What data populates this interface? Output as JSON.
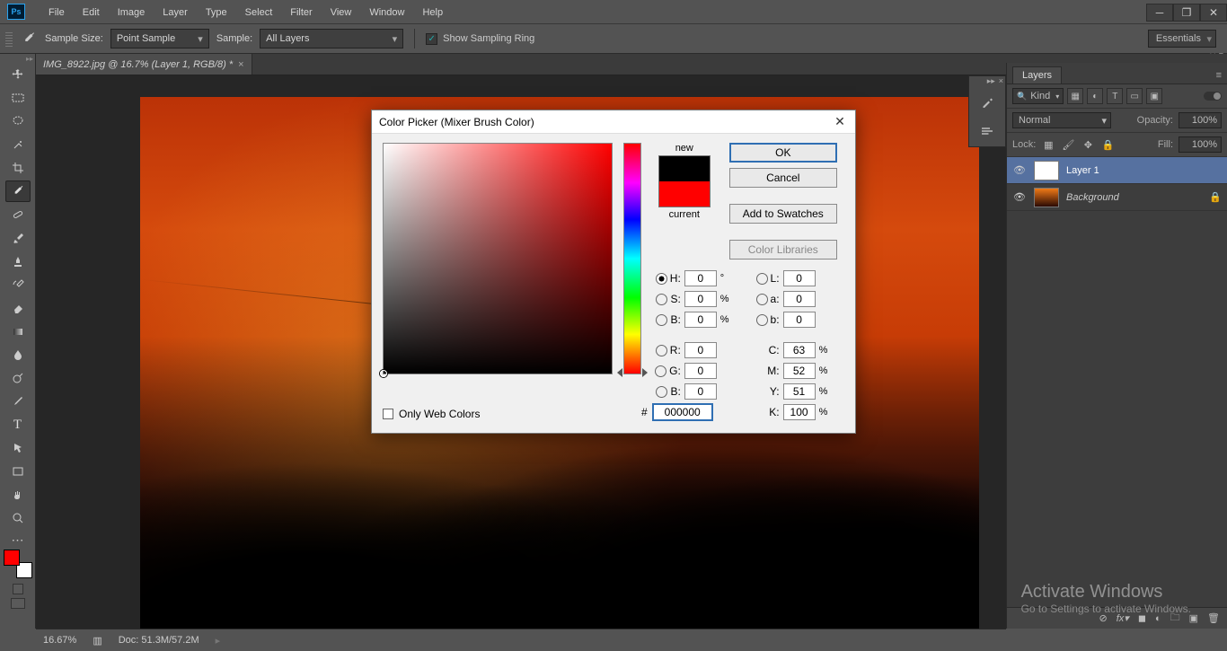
{
  "app": {
    "icon_label": "Ps"
  },
  "menubar": [
    "File",
    "Edit",
    "Image",
    "Layer",
    "Type",
    "Select",
    "Filter",
    "View",
    "Window",
    "Help"
  ],
  "optionsbar": {
    "sample_size_label": "Sample Size:",
    "sample_size_value": "Point Sample",
    "sample_label": "Sample:",
    "sample_value": "All Layers",
    "show_ring_label": "Show Sampling Ring",
    "show_ring_checked": "✓",
    "workspace": "Essentials"
  },
  "document": {
    "tab_title": "IMG_8922.jpg @ 16.7% (Layer 1, RGB/8) *"
  },
  "layers_panel": {
    "tab": "Layers",
    "filter_kind": "Kind",
    "blend_mode_label": "Normal",
    "opacity_label": "Opacity:",
    "opacity_value": "100%",
    "lock_label": "Lock:",
    "fill_label": "Fill:",
    "fill_value": "100%",
    "layers": [
      {
        "name": "Layer 1",
        "locked": false,
        "thumb": "white",
        "selected": true
      },
      {
        "name": "Background",
        "locked": true,
        "thumb": "img",
        "selected": false,
        "italic": true
      }
    ]
  },
  "statusbar": {
    "zoom": "16.67%",
    "doc_label": "Doc:",
    "doc_value": "51.3M/57.2M"
  },
  "watermark": {
    "line1": "Activate Windows",
    "line2": "Go to Settings to activate Windows."
  },
  "color_picker": {
    "title": "Color Picker (Mixer Brush Color)",
    "new_label": "new",
    "current_label": "current",
    "ok": "OK",
    "cancel": "Cancel",
    "add_swatches": "Add to Swatches",
    "color_libraries": "Color Libraries",
    "only_web": "Only Web Colors",
    "hex_label": "#",
    "hex_value": "000000",
    "hsb": {
      "H": "0",
      "S": "0",
      "B": "0",
      "H_unit": "°",
      "SB_unit": "%"
    },
    "lab": {
      "L": "0",
      "a": "0",
      "b": "0"
    },
    "rgb": {
      "R": "0",
      "G": "0",
      "B": "0"
    },
    "cmyk": {
      "C": "63",
      "M": "52",
      "Y": "51",
      "K": "100",
      "unit": "%"
    }
  },
  "icons": {
    "move": "✥",
    "marquee": "▭",
    "lasso": "⌇",
    "wand": "✨",
    "crop": "⌗",
    "eyedrop": "drop",
    "heal": "✚",
    "brush": "🖌",
    "stamp": "⌫",
    "history": "↺",
    "eraser": "◧",
    "gradient": "▤",
    "blur": "●",
    "dodge": "◐",
    "pen": "✎",
    "type": "T",
    "path": "↖",
    "shape": "■",
    "hand": "✋",
    "zoom": "🔍"
  }
}
